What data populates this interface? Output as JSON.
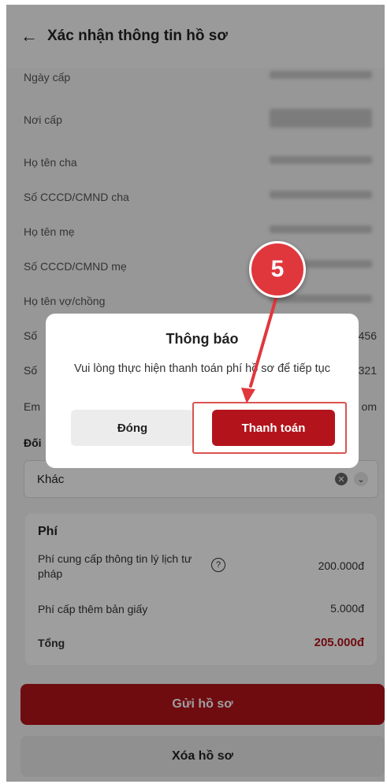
{
  "header": {
    "back_icon": "←",
    "title": "Xác nhận thông tin hồ sơ"
  },
  "fields": [
    {
      "label": "Ngày cấp"
    },
    {
      "label": "Nơi cấp"
    },
    {
      "label": "Họ tên cha"
    },
    {
      "label": "Số CCCD/CMND cha"
    },
    {
      "label": "Họ tên mẹ"
    },
    {
      "label": "Số CCCD/CMND mẹ"
    },
    {
      "label": "Họ tên vợ/chồng"
    }
  ],
  "obscured": {
    "left1": "Số",
    "right1": "456",
    "left2": "Số",
    "right2": "321",
    "left3": "Em",
    "right3": "om",
    "left4": "Đối"
  },
  "select": {
    "value": "Khác"
  },
  "fees": {
    "title": "Phí",
    "items": [
      {
        "label": "Phí cung cấp thông tin lý lịch tư pháp",
        "amount": "200.000đ"
      },
      {
        "label": "Phí cấp thêm bản giấy",
        "amount": "5.000đ"
      }
    ],
    "total_label": "Tổng",
    "total_amount": "205.000đ"
  },
  "buttons": {
    "send": "Gửi hồ sơ",
    "delete": "Xóa hồ sơ"
  },
  "dialog": {
    "title": "Thông báo",
    "message": "Vui lòng thực hiện thanh toán phí hồ sơ để tiếp tục",
    "close": "Đóng",
    "pay": "Thanh toán"
  },
  "annotation": {
    "step": "5"
  },
  "colors": {
    "accent": "#b3141b",
    "annotation": "#e0373d"
  }
}
